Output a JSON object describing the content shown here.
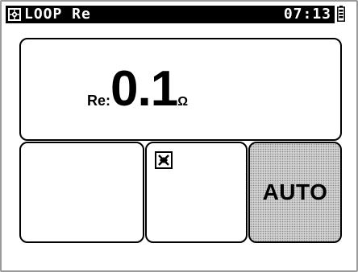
{
  "header": {
    "title": "LOOP Re",
    "time": "07:13",
    "menu_icon": "function-selector-icon",
    "battery_icon": "battery-icon"
  },
  "measurement": {
    "label": "Re:",
    "value": "0.1",
    "unit": "Ω"
  },
  "panels": {
    "status_icon": "rcd-disabled-icon",
    "mode_label": "AUTO"
  }
}
